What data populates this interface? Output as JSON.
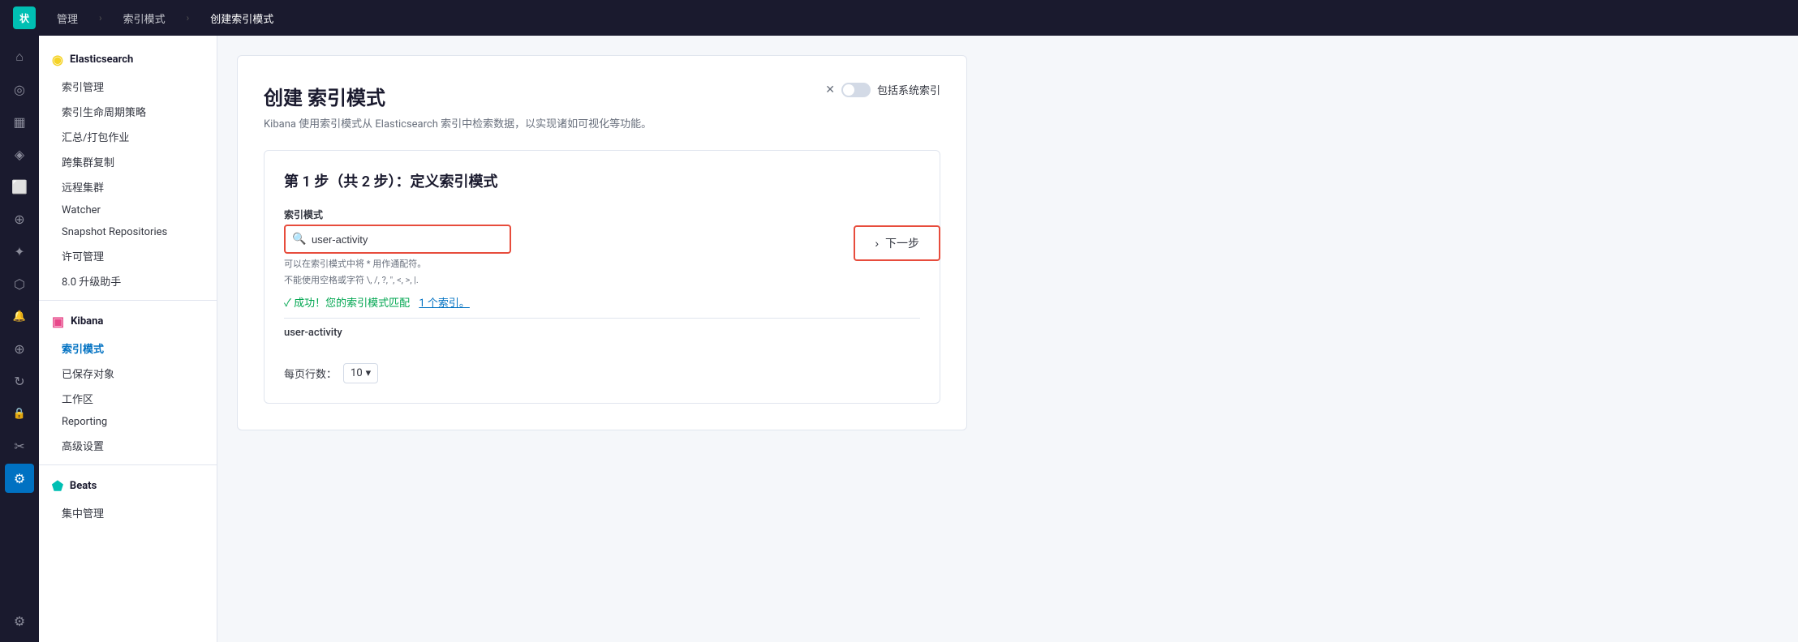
{
  "topnav": {
    "logo_text": "状",
    "items": [
      "管理",
      "索引模式",
      "创建索引模式"
    ],
    "separators": [
      ">",
      ">"
    ]
  },
  "icon_sidebar": {
    "items": [
      {
        "name": "home-icon",
        "glyph": "⌂",
        "active": false
      },
      {
        "name": "discover-icon",
        "glyph": "○",
        "active": false
      },
      {
        "name": "dashboard-icon",
        "glyph": "▦",
        "active": false
      },
      {
        "name": "visualize-icon",
        "glyph": "◈",
        "active": false
      },
      {
        "name": "canvas-icon",
        "glyph": "⬜",
        "active": false
      },
      {
        "name": "maps-icon",
        "glyph": "◎",
        "active": false
      },
      {
        "name": "ml-icon",
        "glyph": "✦",
        "active": false
      },
      {
        "name": "graph-icon",
        "glyph": "⬡",
        "active": false
      },
      {
        "name": "alerting-icon",
        "glyph": "🔔",
        "active": false
      },
      {
        "name": "apm-icon",
        "glyph": "⊕",
        "active": false
      },
      {
        "name": "uptime-icon",
        "glyph": "↻",
        "active": false
      },
      {
        "name": "security-icon",
        "glyph": "🔒",
        "active": false
      },
      {
        "name": "dev-tools-icon",
        "glyph": "⚙",
        "active": false
      },
      {
        "name": "stack-monitoring-icon",
        "glyph": "⊞",
        "active": false
      },
      {
        "name": "management-icon",
        "glyph": "⚙",
        "active": true
      },
      {
        "name": "settings-icon",
        "glyph": "⚙",
        "active": false
      }
    ]
  },
  "left_nav": {
    "sections": [
      {
        "title": "Elasticsearch",
        "icon_type": "es",
        "items": [
          {
            "label": "索引管理",
            "active": false
          },
          {
            "label": "索引生命周期策略",
            "active": false
          },
          {
            "label": "汇总/打包作业",
            "active": false
          },
          {
            "label": "跨集群复制",
            "active": false
          },
          {
            "label": "远程集群",
            "active": false
          },
          {
            "label": "Watcher",
            "active": false
          },
          {
            "label": "Snapshot Repositories",
            "active": false
          },
          {
            "label": "许可管理",
            "active": false
          },
          {
            "label": "8.0 升级助手",
            "active": false
          }
        ]
      },
      {
        "title": "Kibana",
        "icon_type": "kibana",
        "items": [
          {
            "label": "索引模式",
            "active": true
          },
          {
            "label": "已保存对象",
            "active": false
          },
          {
            "label": "工作区",
            "active": false
          },
          {
            "label": "Reporting",
            "active": false
          },
          {
            "label": "高级设置",
            "active": false
          }
        ]
      },
      {
        "title": "Beats",
        "icon_type": "beats",
        "items": [
          {
            "label": "集中管理",
            "active": false
          }
        ]
      }
    ]
  },
  "main": {
    "card": {
      "title": "创建 索引模式",
      "subtitle": "Kibana 使用索引模式从 Elasticsearch 索引中检索数据，以实现诸如可视化等功能。",
      "include_system_label": "包括系统索引",
      "step": {
        "title": "第 1 步（共 2 步）：定义索引模式",
        "field_label": "索引模式",
        "input_placeholder": "user-activity",
        "input_value": "user-activity",
        "hint_line1": "可以在索引模式中将 * 用作通配符。",
        "hint_line2": "不能使用空格或字符 \\, /, ?, \", <, >, |.",
        "success_text": "✓ 成功！您的索引模式匹配",
        "success_link": "1 个索引。",
        "result_item": "user-activity",
        "pagination_label": "每页行数：",
        "pagination_value": "10",
        "pagination_icon": "▾"
      }
    },
    "next_button_label": "下一步",
    "next_button_icon": "›"
  }
}
